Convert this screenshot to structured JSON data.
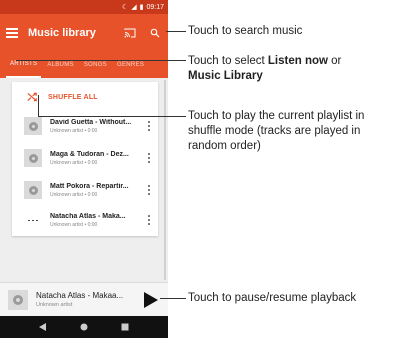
{
  "status_bar": {
    "time": "09:17"
  },
  "app_bar": {
    "title": "Music library"
  },
  "tabs": [
    "ARTISTS",
    "ALBUMS",
    "SONGS",
    "GENRES"
  ],
  "shuffle_label": "SHUFFLE ALL",
  "tracks": [
    {
      "title": "David Guetta - Without...",
      "subtitle": "Unknown artist • 0:00"
    },
    {
      "title": "Maga & Tudoran - Dez...",
      "subtitle": "Unknown artist • 0:00"
    },
    {
      "title": "Matt Pokora - Repartir...",
      "subtitle": "Unknown artist • 0:00"
    },
    {
      "title": "Natacha Atlas - Maka...",
      "subtitle": "Unknown artist • 0:00"
    }
  ],
  "now_playing": {
    "title": "Natacha Atlas - Makaa...",
    "subtitle": "Unknown artist"
  },
  "callouts": {
    "search": "Touch to search music",
    "select_prefix": "Touch to select ",
    "listen_now": "Listen now",
    "or": " or",
    "music_library": "Music Library",
    "shuffle": "Touch to play the current playlist in shuffle mode (tracks are played in random order)",
    "playpause": "Touch to pause/resume playback"
  },
  "colors": {
    "accent": "#e8522a",
    "status_bar": "#c8391b"
  }
}
